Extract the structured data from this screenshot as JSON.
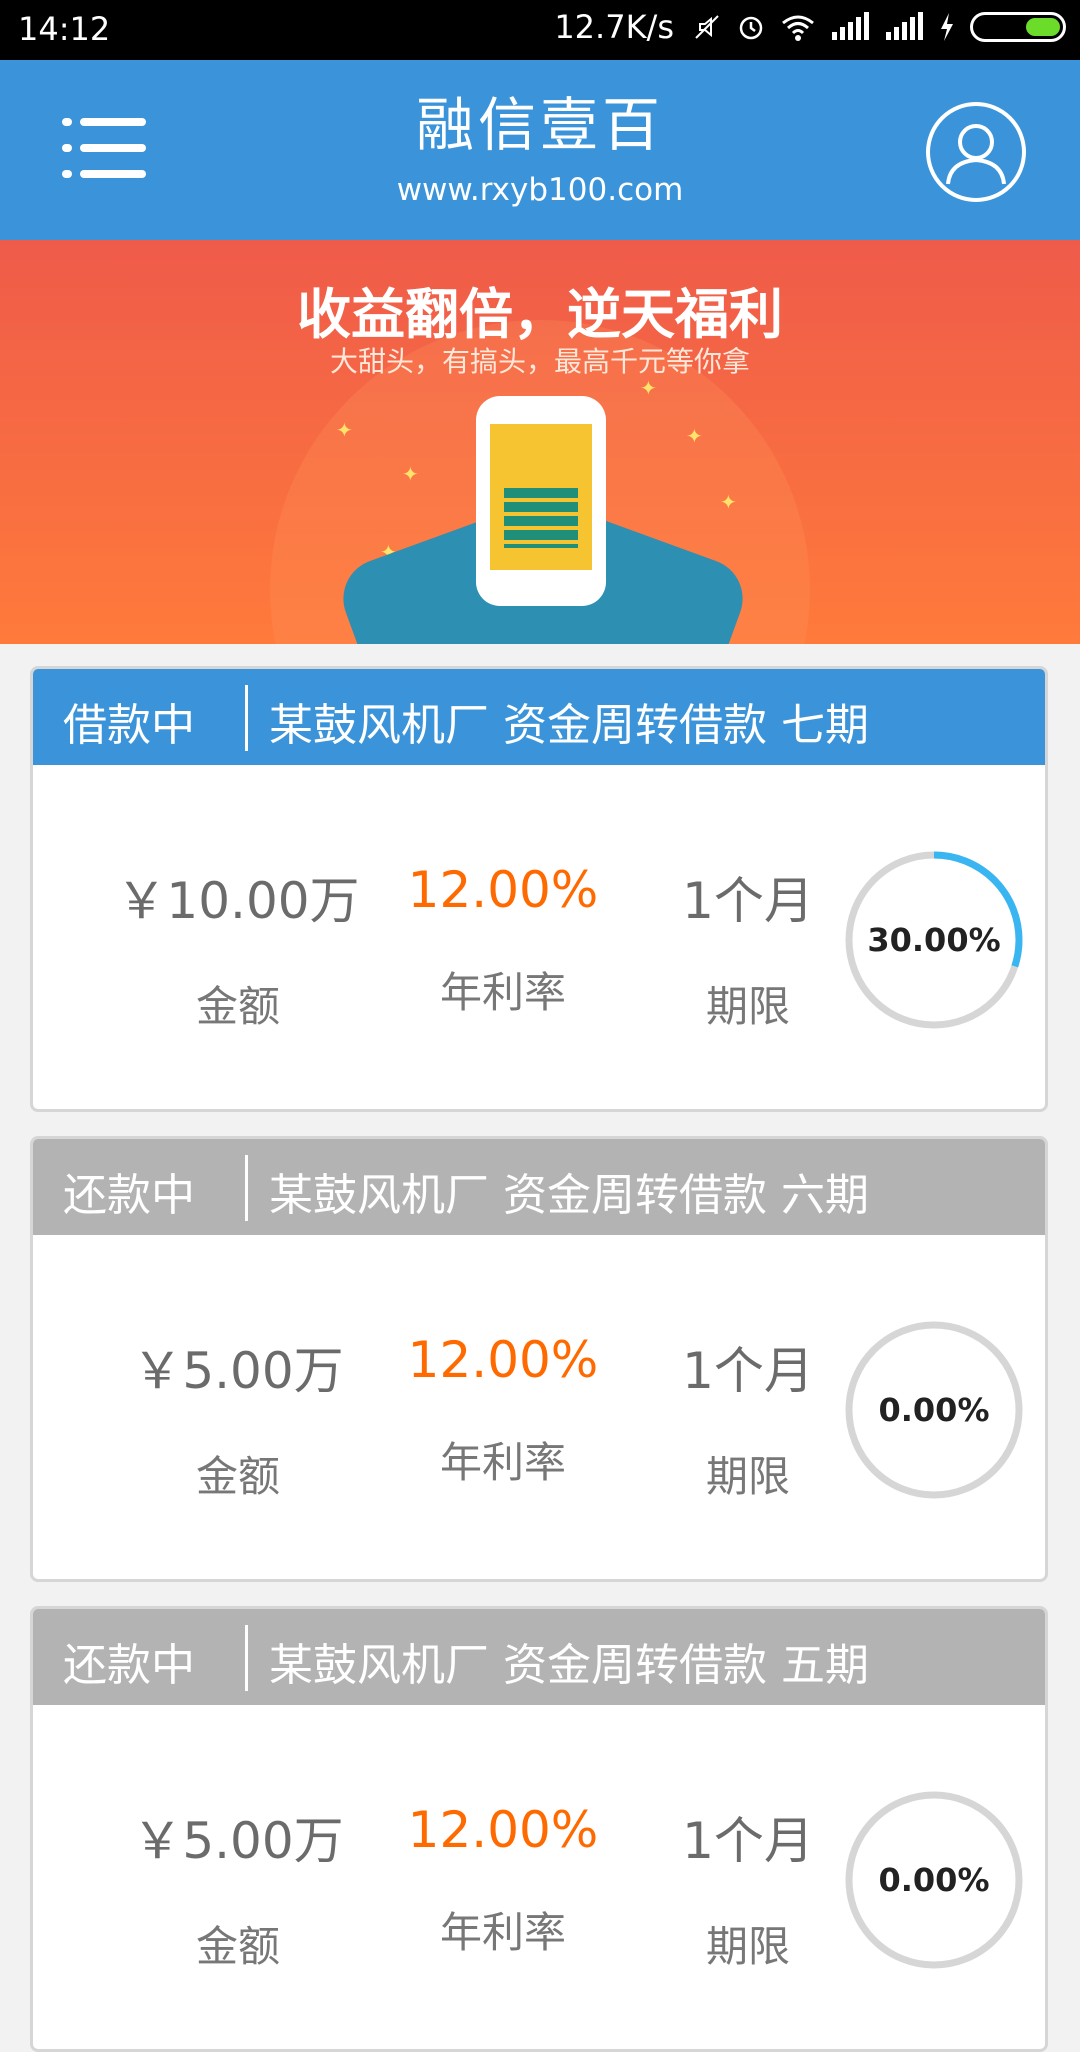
{
  "status_bar": {
    "time": "14:12",
    "network_speed": "12.7K/s",
    "icons": [
      "mute-icon",
      "alarm-icon",
      "wifi-icon",
      "signal-icon",
      "signal-icon",
      "charging-icon",
      "battery-icon"
    ]
  },
  "header": {
    "title": "融信壹百",
    "subtitle": "www.rxyb100.com",
    "menu_icon": "menu-icon",
    "profile_icon": "user-profile-icon",
    "background": "#3b94d9"
  },
  "banner": {
    "headline": "收益翻倍，逆天福利",
    "subline": "大甜头，有搞头，最高千元等你拿",
    "dots_count": 2
  },
  "loans": [
    {
      "status": "借款中",
      "name": "某鼓风机厂 资金周转借款 七期",
      "amount": "￥10.00万",
      "amount_label": "金额",
      "rate": "12.00%",
      "rate_label": "年利率",
      "term": "1个月",
      "term_label": "期限",
      "progress_text": "30.00%",
      "progress": 0.3,
      "header_color": "#3b94d9"
    },
    {
      "status": "还款中",
      "name": "某鼓风机厂 资金周转借款 六期",
      "amount": "￥5.00万",
      "amount_label": "金额",
      "rate": "12.00%",
      "rate_label": "年利率",
      "term": "1个月",
      "term_label": "期限",
      "progress_text": "0.00%",
      "progress": 0.0,
      "header_color": "#b3b3b3"
    },
    {
      "status": "还款中",
      "name": "某鼓风机厂 资金周转借款 五期",
      "amount": "￥5.00万",
      "amount_label": "金额",
      "rate": "12.00%",
      "rate_label": "年利率",
      "term": "1个月",
      "term_label": "期限",
      "progress_text": "0.00%",
      "progress": 0.0,
      "header_color": "#b3b3b3"
    }
  ]
}
